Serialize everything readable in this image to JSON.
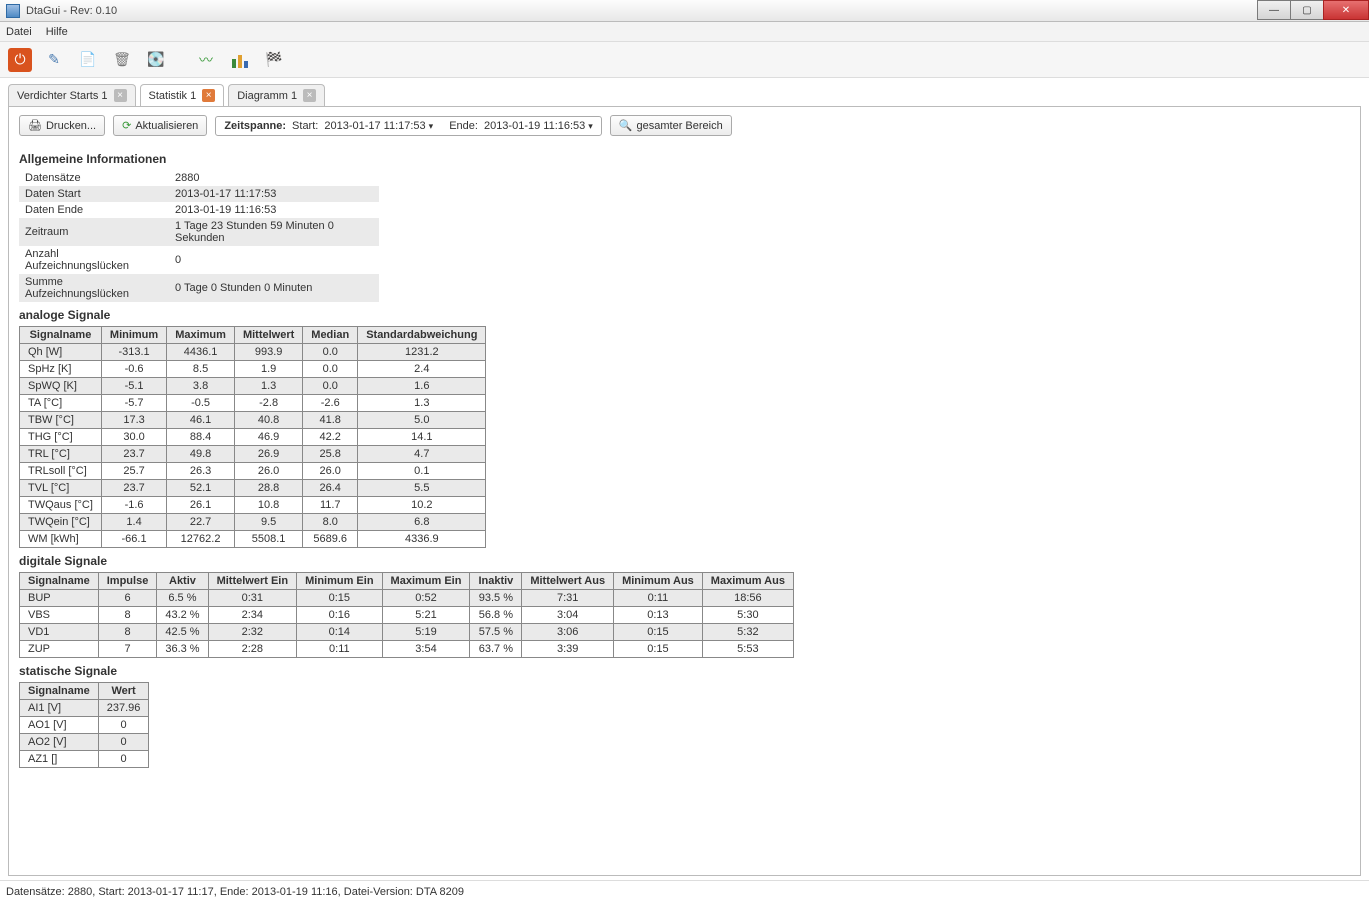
{
  "window": {
    "title": "DtaGui - Rev: 0.10"
  },
  "menu": {
    "file": "Datei",
    "help": "Hilfe"
  },
  "tabs": [
    {
      "label": "Verdichter Starts 1",
      "active": false
    },
    {
      "label": "Statistik 1",
      "active": true
    },
    {
      "label": "Diagramm 1",
      "active": false
    }
  ],
  "subtoolbar": {
    "print": "Drucken...",
    "refresh": "Aktualisieren",
    "timespan_label": "Zeitspanne:",
    "start_label": "Start:",
    "start_value": "2013-01-17 11:17:53",
    "end_label": "Ende:",
    "end_value": "2013-01-19 11:16:53",
    "full_range": "gesamter Bereich"
  },
  "sections": {
    "general": "Allgemeine Informationen",
    "analog": "analoge Signale",
    "digital": "digitale Signale",
    "static": "statische Signale"
  },
  "general_info": [
    {
      "label": "Datensätze",
      "value": "2880"
    },
    {
      "label": "Daten Start",
      "value": "2013-01-17 11:17:53"
    },
    {
      "label": "Daten Ende",
      "value": "2013-01-19 11:16:53"
    },
    {
      "label": "Zeitraum",
      "value": "1 Tage 23 Stunden 59 Minuten 0 Sekunden"
    },
    {
      "label": "Anzahl Aufzeichnungslücken",
      "value": "0"
    },
    {
      "label": "Summe Aufzeichnungslücken",
      "value": "0 Tage 0 Stunden 0 Minuten"
    }
  ],
  "analog_headers": [
    "Signalname",
    "Minimum",
    "Maximum",
    "Mittelwert",
    "Median",
    "Standardabweichung"
  ],
  "analog_rows": [
    [
      "Qh [W]",
      "-313.1",
      "4436.1",
      "993.9",
      "0.0",
      "1231.2"
    ],
    [
      "SpHz [K]",
      "-0.6",
      "8.5",
      "1.9",
      "0.0",
      "2.4"
    ],
    [
      "SpWQ [K]",
      "-5.1",
      "3.8",
      "1.3",
      "0.0",
      "1.6"
    ],
    [
      "TA [°C]",
      "-5.7",
      "-0.5",
      "-2.8",
      "-2.6",
      "1.3"
    ],
    [
      "TBW [°C]",
      "17.3",
      "46.1",
      "40.8",
      "41.8",
      "5.0"
    ],
    [
      "THG [°C]",
      "30.0",
      "88.4",
      "46.9",
      "42.2",
      "14.1"
    ],
    [
      "TRL [°C]",
      "23.7",
      "49.8",
      "26.9",
      "25.8",
      "4.7"
    ],
    [
      "TRLsoll [°C]",
      "25.7",
      "26.3",
      "26.0",
      "26.0",
      "0.1"
    ],
    [
      "TVL [°C]",
      "23.7",
      "52.1",
      "28.8",
      "26.4",
      "5.5"
    ],
    [
      "TWQaus [°C]",
      "-1.6",
      "26.1",
      "10.8",
      "11.7",
      "10.2"
    ],
    [
      "TWQein [°C]",
      "1.4",
      "22.7",
      "9.5",
      "8.0",
      "6.8"
    ],
    [
      "WM [kWh]",
      "-66.1",
      "12762.2",
      "5508.1",
      "5689.6",
      "4336.9"
    ]
  ],
  "digital_headers": [
    "Signalname",
    "Impulse",
    "Aktiv",
    "Mittelwert Ein",
    "Minimum Ein",
    "Maximum Ein",
    "Inaktiv",
    "Mittelwert Aus",
    "Minimum Aus",
    "Maximum Aus"
  ],
  "digital_rows": [
    [
      "BUP",
      "6",
      "6.5 %",
      "0:31",
      "0:15",
      "0:52",
      "93.5 %",
      "7:31",
      "0:11",
      "18:56"
    ],
    [
      "VBS",
      "8",
      "43.2 %",
      "2:34",
      "0:16",
      "5:21",
      "56.8 %",
      "3:04",
      "0:13",
      "5:30"
    ],
    [
      "VD1",
      "8",
      "42.5 %",
      "2:32",
      "0:14",
      "5:19",
      "57.5 %",
      "3:06",
      "0:15",
      "5:32"
    ],
    [
      "ZUP",
      "7",
      "36.3 %",
      "2:28",
      "0:11",
      "3:54",
      "63.7 %",
      "3:39",
      "0:15",
      "5:53"
    ]
  ],
  "static_headers": [
    "Signalname",
    "Wert"
  ],
  "static_rows": [
    [
      "AI1 [V]",
      "237.96"
    ],
    [
      "AO1 [V]",
      "0"
    ],
    [
      "AO2 [V]",
      "0"
    ],
    [
      "AZ1 []",
      "0"
    ]
  ],
  "statusbar": "Datensätze: 2880, Start: 2013-01-17 11:17, Ende: 2013-01-19 11:16, Datei-Version: DTA 8209"
}
